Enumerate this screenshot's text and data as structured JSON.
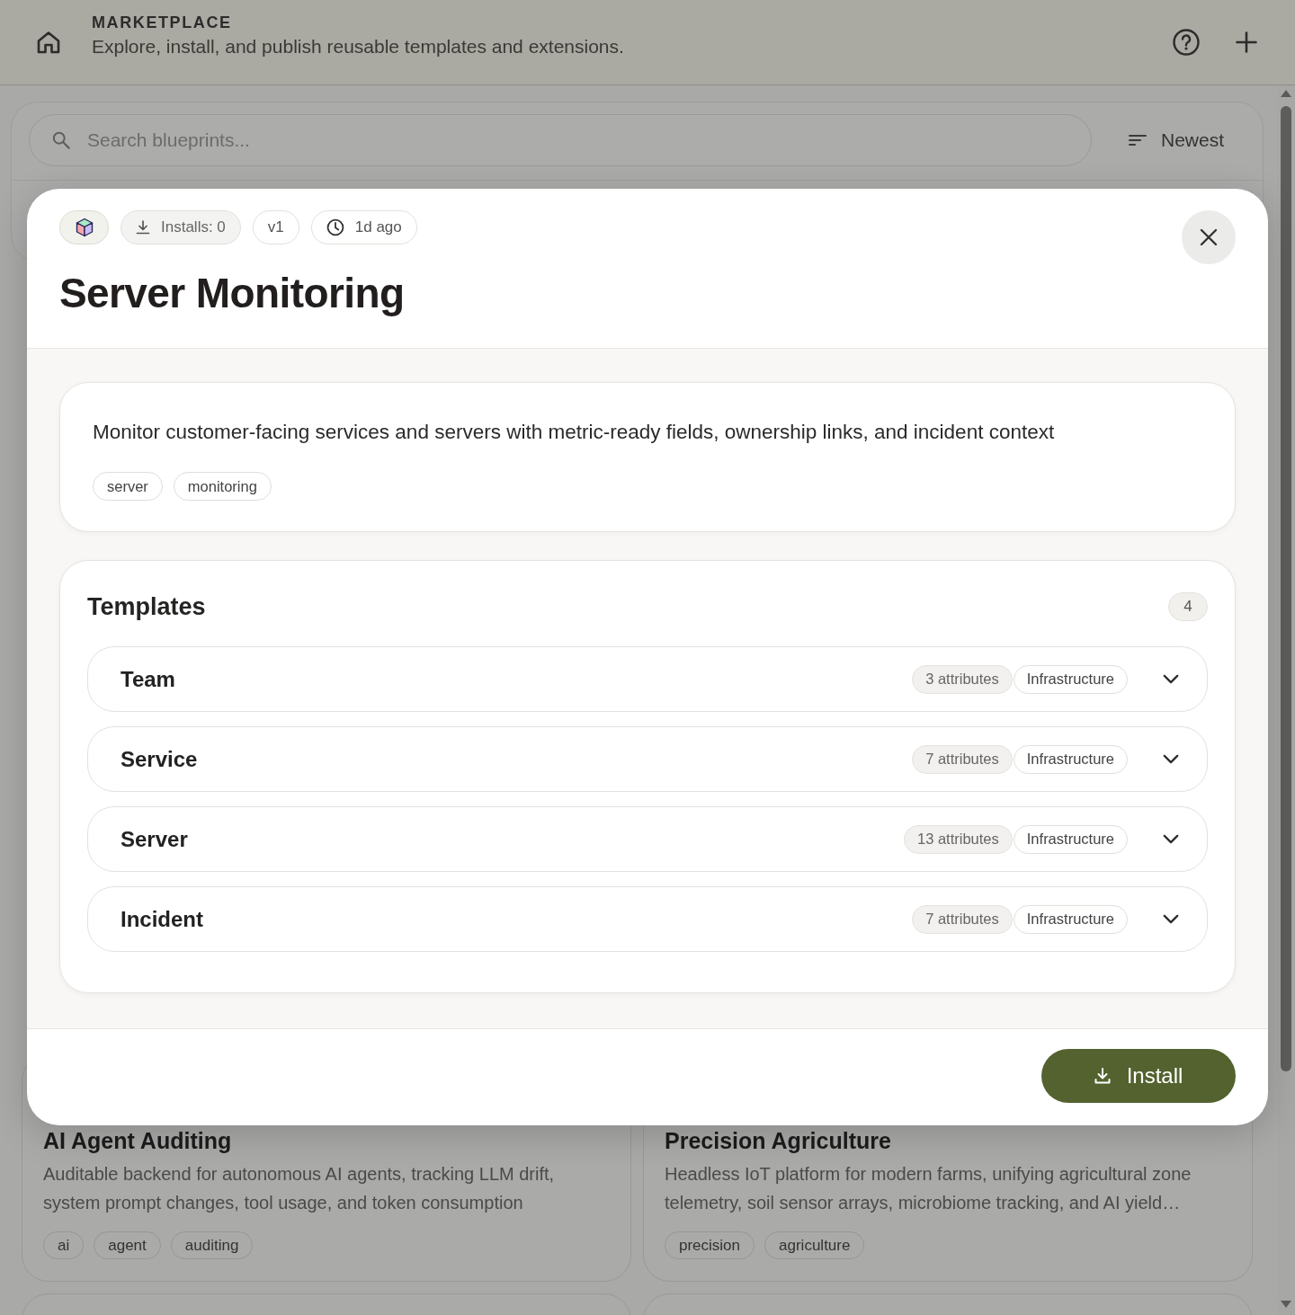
{
  "header": {
    "eyebrow": "MARKETPLACE",
    "subtitle": "Explore, install, and publish reusable templates and extensions."
  },
  "search": {
    "placeholder": "Search blueprints..."
  },
  "sort": {
    "label": "Newest"
  },
  "cards": [
    {
      "title": "AI Agent Auditing",
      "description": "Auditable backend for autonomous AI agents, tracking LLM drift, system prompt changes, tool usage, and token consumption",
      "tags": [
        "ai",
        "agent",
        "auditing"
      ]
    },
    {
      "title": "Precision Agriculture",
      "description": "Headless IoT platform for modern farms, unifying agricultural zone telemetry, soil sensor arrays, microbiome tracking, and AI yield…",
      "tags": [
        "precision",
        "agriculture"
      ]
    }
  ],
  "modal": {
    "installs": "Installs: 0",
    "version": "v1",
    "updated": "1d ago",
    "title": "Server Monitoring",
    "description": "Monitor customer-facing services and servers with metric-ready fields, ownership links, and incident context",
    "tags": [
      "server",
      "monitoring"
    ],
    "templates": {
      "title": "Templates",
      "count": "4",
      "items": [
        {
          "name": "Team",
          "attributes": "3 attributes",
          "category": "Infrastructure",
          "expanded": false
        },
        {
          "name": "Service",
          "attributes": "7 attributes",
          "category": "Infrastructure",
          "expanded": false
        },
        {
          "name": "Server",
          "attributes": "13 attributes",
          "category": "Infrastructure",
          "expanded": false
        },
        {
          "name": "Incident",
          "attributes": "7 attributes",
          "category": "Infrastructure",
          "expanded": false
        }
      ]
    },
    "install_button": "Install"
  }
}
